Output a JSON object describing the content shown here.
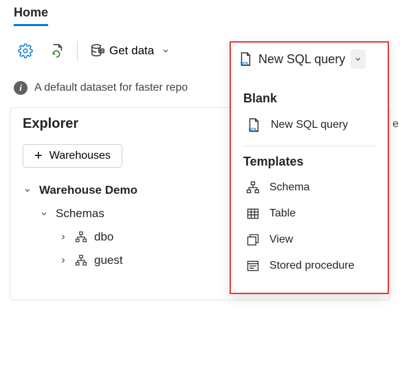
{
  "tabs": {
    "home": "Home"
  },
  "toolbar": {
    "get_data_label": "Get data",
    "new_sql_label": "New SQL query"
  },
  "info_bar": {
    "message": "A default dataset for faster repo"
  },
  "edge_char": "e",
  "explorer": {
    "title": "Explorer",
    "warehouses_button": "Warehouses",
    "tree": {
      "root": "Warehouse Demo",
      "schemas_label": "Schemas",
      "schemas": [
        "dbo",
        "guest"
      ]
    }
  },
  "dropdown": {
    "header_label": "New SQL query",
    "section_blank": "Blank",
    "item_new_sql": "New SQL query",
    "section_templates": "Templates",
    "item_schema": "Schema",
    "item_table": "Table",
    "item_view": "View",
    "item_stored_proc": "Stored procedure"
  }
}
